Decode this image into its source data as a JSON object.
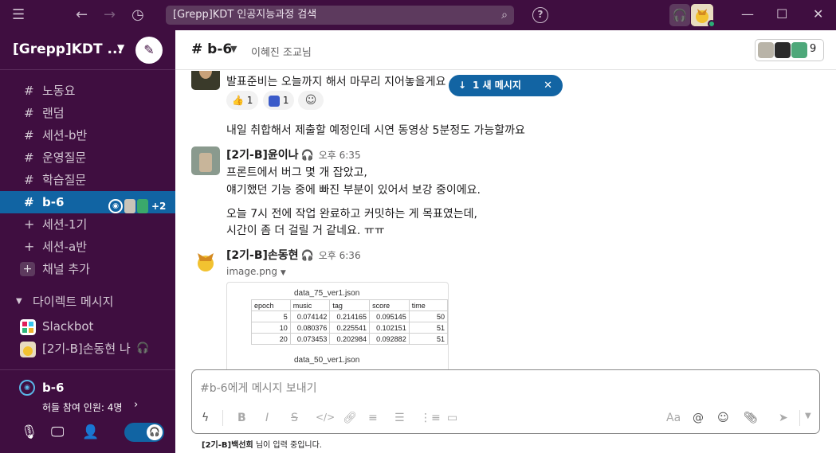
{
  "topbar": {
    "search_text": "[Grepp]KDT 인공지능과정 검색",
    "help": "?"
  },
  "sidebar": {
    "workspace": "[Grepp]KDT ...",
    "channels": [
      {
        "label": "노동요"
      },
      {
        "label": "랜덤"
      },
      {
        "label": "세션-b반"
      },
      {
        "label": "운영질문"
      },
      {
        "label": "학습질문"
      },
      {
        "label": "b-6",
        "active": true,
        "extra": "+2"
      },
      {
        "label": "세션-1기"
      },
      {
        "label": "세션-a반"
      },
      {
        "label": "채널 추가"
      }
    ],
    "dm_header": "다이렉트 메시지",
    "dms": [
      {
        "label": "Slackbot"
      },
      {
        "label": "[2기-B]손동현  나"
      }
    ],
    "huddle": {
      "channel": "b-6",
      "count": "허들 참여 인원: 4명"
    }
  },
  "header": {
    "channel": "# b-6",
    "topic": "이혜진 조교님",
    "member_count": "9"
  },
  "new_messages_pill": {
    "label": "1 새 메시지"
  },
  "messages": [
    {
      "text": "발표준비는 오늘까지 해서 마무리 지어놓을게요"
    },
    {
      "reactions": [
        {
          "emoji": "👍",
          "count": "1"
        },
        {
          "count": "1"
        }
      ]
    },
    {
      "text": "내일 취합해서 제출할 예정인데 시연 동영상 5분정도 가능할까요"
    },
    {
      "sender": "[2기-B]윤이나",
      "time": "오후 6:35",
      "lines": [
        "프론트에서 버그 몇 개 잡았고,",
        "얘기했던 기능 중에 빠진 부분이 있어서 보강 중이에요."
      ],
      "lines2": [
        "오늘 7시 전에 작업 완료하고 커밋하는 게 목표였는데,",
        "시간이 좀 더 걸릴 거 같네요. ㅠㅠ"
      ]
    },
    {
      "sender": "[2기-B]손동현",
      "time": "오후 6:36",
      "file": "image.png",
      "image_table": {
        "title1": "data_75_ver1.json",
        "headers": [
          "epoch",
          "music",
          "tag",
          "score",
          "time"
        ],
        "rows": [
          [
            "5",
            "0.074142",
            "0.214165",
            "0.095145",
            "50"
          ],
          [
            "10",
            "0.080376",
            "0.225541",
            "0.102151",
            "51"
          ],
          [
            "20",
            "0.073453",
            "0.202984",
            "0.092882",
            "51"
          ]
        ],
        "title2": "data_50_ver1.json"
      }
    }
  ],
  "composer": {
    "placeholder": "#b-6에게 메시지 보내기",
    "aa": "Aa",
    "at": "@"
  },
  "typing": {
    "name": "[2기-B]백선희",
    "suffix": " 님이 입력 중입니다."
  },
  "colors": {
    "sidebar": "#3f0e40",
    "active": "#1164a3",
    "pill": "#1264a3"
  }
}
